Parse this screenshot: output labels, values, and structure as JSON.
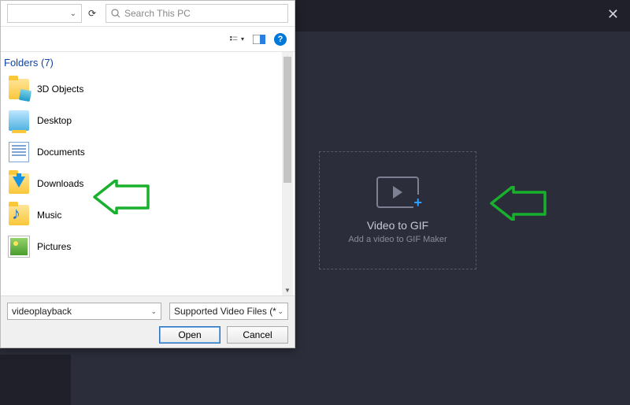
{
  "app": {
    "dropzone": {
      "title": "Video to GIF",
      "subtitle": "Add a video to GIF Maker"
    }
  },
  "dialog": {
    "search_placeholder": "Search This PC",
    "section": {
      "label": "Folders",
      "count": 7
    },
    "folders": [
      {
        "label": "3D Objects"
      },
      {
        "label": "Desktop"
      },
      {
        "label": "Documents"
      },
      {
        "label": "Downloads"
      },
      {
        "label": "Music"
      },
      {
        "label": "Pictures"
      }
    ],
    "filename": "videoplayback",
    "filter": "Supported Video Files (*.ts;*.mt",
    "buttons": {
      "open": "Open",
      "cancel": "Cancel"
    }
  }
}
